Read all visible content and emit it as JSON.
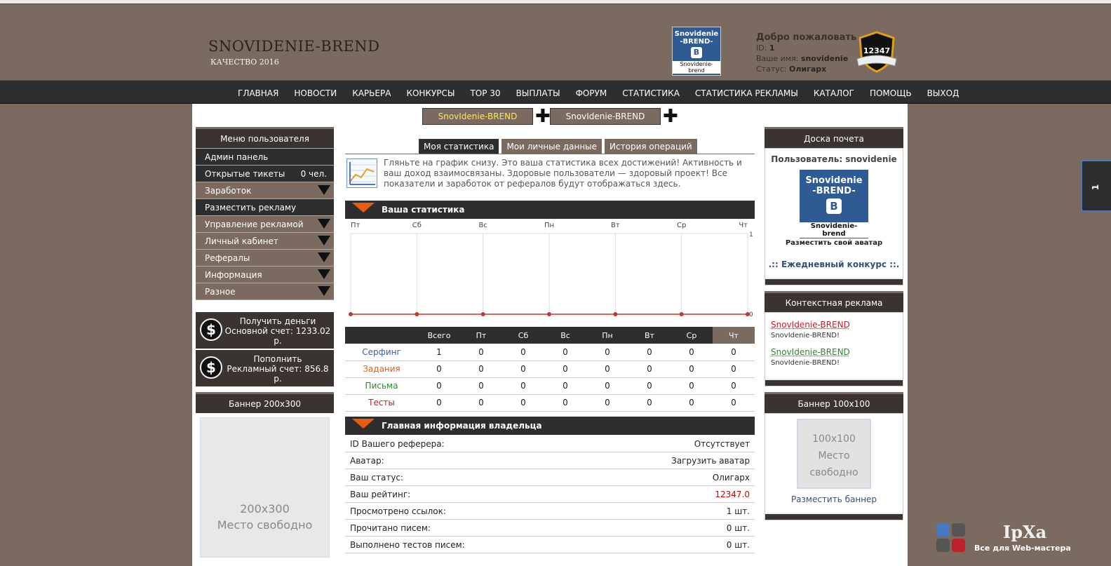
{
  "site": {
    "title": "SNOVIDENIE-BREND",
    "subtitle": "КАЧЕСТВО 2016"
  },
  "avatar_small": {
    "line1": "Snovidenie",
    "line2": "-BREND-",
    "letter": "B",
    "line3": "Snovidenie-brend"
  },
  "welcome": {
    "title": "Добро пожаловать",
    "id_label": "ID:",
    "id_value": "1",
    "name_label": "Ваше имя:",
    "name_value": "snovidenie",
    "status_label": "Статус:",
    "status_value": "Олигарх"
  },
  "rating_badge": "12347",
  "nav": [
    "ГЛАВНАЯ",
    "НОВОСТИ",
    "КАРЬЕРА",
    "КОНКУРСЫ",
    "TOP 30",
    "ВЫПЛАТЫ",
    "ФОРУМ",
    "СТАТИСТИКА",
    "СТАТИСТИКА РЕКЛАМЫ",
    "КАТАЛОГ",
    "ПОМОЩЬ",
    "ВЫХОД"
  ],
  "promo": {
    "left": "SnovIdenie-BREND",
    "right": "SnovIdenie-BREND",
    "plus": "✚"
  },
  "user_menu": {
    "title": "Меню пользователя",
    "items": [
      {
        "label": "Админ панель"
      },
      {
        "label": "Открытые тикеты",
        "count": "0 чел."
      },
      {
        "label": "Заработок"
      },
      {
        "label": "Разместить рекламу"
      },
      {
        "label": "Управление рекламой"
      },
      {
        "label": "Личный кабинет"
      },
      {
        "label": "Рефералы"
      },
      {
        "label": "Информация"
      },
      {
        "label": "Разное"
      }
    ]
  },
  "money": {
    "get": {
      "line1": "Получить деньги",
      "line2": "Основной счет: 1233.02 р."
    },
    "topup": {
      "line1": "Пополнить",
      "line2": "Рекламный счет: 856.8 р."
    },
    "symbol": "$"
  },
  "banner_left": {
    "title": "Баннер 200x300",
    "size": "200x300",
    "free": "Место свободно"
  },
  "tabs": [
    "Моя статистика",
    "Мои личные данные",
    "История операций"
  ],
  "intro": "Гляньте на график снизу. Это ваша статистика всех достижений! Активность и ваш доход взаимосвязаны. Здоровые пользователи — здоровый проект! Все показатели и заработок от рефералов будут отображаться здесь.",
  "stats_section_title": "Ваша статистика",
  "chart_data": {
    "type": "line",
    "categories": [
      "Пт",
      "Сб",
      "Вс",
      "Пн",
      "Вт",
      "Ср",
      "Чт"
    ],
    "values": [
      0,
      0,
      0,
      0,
      0,
      0,
      0
    ],
    "ylim": [
      0,
      1
    ],
    "y_ticks": [
      "1",
      "0"
    ],
    "grid": true,
    "line_color": "#c0392b"
  },
  "stats_table": {
    "headers": [
      "",
      "Всего",
      "Пт",
      "Сб",
      "Вс",
      "Пн",
      "Вт",
      "Ср",
      "Чт"
    ],
    "rows": [
      {
        "label": "Серфинг",
        "color": "#3a5fa0",
        "values": [
          "1",
          "0",
          "0",
          "0",
          "0",
          "0",
          "0",
          "0"
        ]
      },
      {
        "label": "Задания",
        "color": "#e85c10",
        "values": [
          "0",
          "0",
          "0",
          "0",
          "0",
          "0",
          "0",
          "0"
        ]
      },
      {
        "label": "Письма",
        "color": "#2a8a2a",
        "values": [
          "0",
          "0",
          "0",
          "0",
          "0",
          "0",
          "0",
          "0"
        ]
      },
      {
        "label": "Тесты",
        "color": "#c0202a",
        "values": [
          "0",
          "0",
          "0",
          "0",
          "0",
          "0",
          "0",
          "0"
        ]
      }
    ]
  },
  "owner_section_title": "Главная информация владельца",
  "owner_rows": [
    {
      "label": "ID Вашего реферера:",
      "value": "Отсутствует"
    },
    {
      "label": "Аватар:",
      "value": "Загрузить аватар"
    },
    {
      "label": "Ваш статус:",
      "value": "Олигарх"
    },
    {
      "label": "Ваш рейтинг:",
      "value": "12347.0",
      "red": true
    },
    {
      "label": "Просмотрено ссылок:",
      "value": "1 шт."
    },
    {
      "label": "Прочитано писем:",
      "value": "0 шт."
    },
    {
      "label": "Выполнено тестов писем:",
      "value": "0 шт."
    }
  ],
  "honor": {
    "title": "Доска почета",
    "user": "Пользователь: snovidenie",
    "av_line1": "Snovidenie",
    "av_line2": "-BREND-",
    "av_letter": "B",
    "av_line3": "Snovidenie-brend",
    "caption": "Разместить свой аватар",
    "contest": ".:: Ежедневный конкурс ::."
  },
  "context_ads": {
    "title": "Контекстная реклама",
    "items": [
      {
        "link": "SnovIdenie-BREND",
        "desc": "SnovIdenie-BREND!",
        "color": "#c0202a"
      },
      {
        "link": "SnovIdenie-BREND",
        "desc": "SnovIdenie-BREND!",
        "color": "#2a8a2a"
      }
    ]
  },
  "banner_right": {
    "title": "Баннер 100x100",
    "size": "100x100",
    "line2": "Место",
    "line3": "свободно",
    "link": "Разместить баннер"
  },
  "side_tab": "1",
  "watermark": {
    "title": "IpXa",
    "sub": "Все для Web-мастера"
  }
}
